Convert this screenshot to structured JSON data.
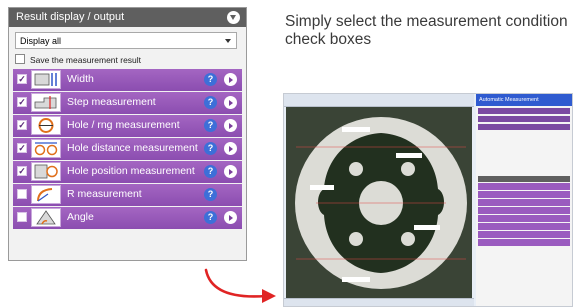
{
  "panel": {
    "title": "Result display / output",
    "select_value": "Display all",
    "save_label": "Save the measurement result",
    "items": [
      {
        "label": "Width",
        "checked": true,
        "icon": "width-icon",
        "play": true
      },
      {
        "label": "Step measurement",
        "checked": true,
        "icon": "step-measurement-icon",
        "play": true
      },
      {
        "label": "Hole / rng measurement",
        "checked": true,
        "icon": "hole-measurement-icon",
        "play": true
      },
      {
        "label": "Hole distance measurement",
        "checked": true,
        "icon": "hole-distance-icon",
        "play": true
      },
      {
        "label": "Hole position measurement",
        "checked": true,
        "icon": "hole-position-icon",
        "play": true
      },
      {
        "label": "R measurement",
        "checked": false,
        "icon": "r-measurement-icon",
        "play": false
      },
      {
        "label": "Angle",
        "checked": false,
        "icon": "angle-icon",
        "play": true
      }
    ]
  },
  "caption": "Simply select the measurement condition check boxes",
  "screenshot": {
    "side_title": "Automatic Measurement"
  },
  "colors": {
    "row": "#9a5bbf",
    "header": "#5f5f5f",
    "help": "#3d6fd8",
    "arrow": "#e02424"
  }
}
